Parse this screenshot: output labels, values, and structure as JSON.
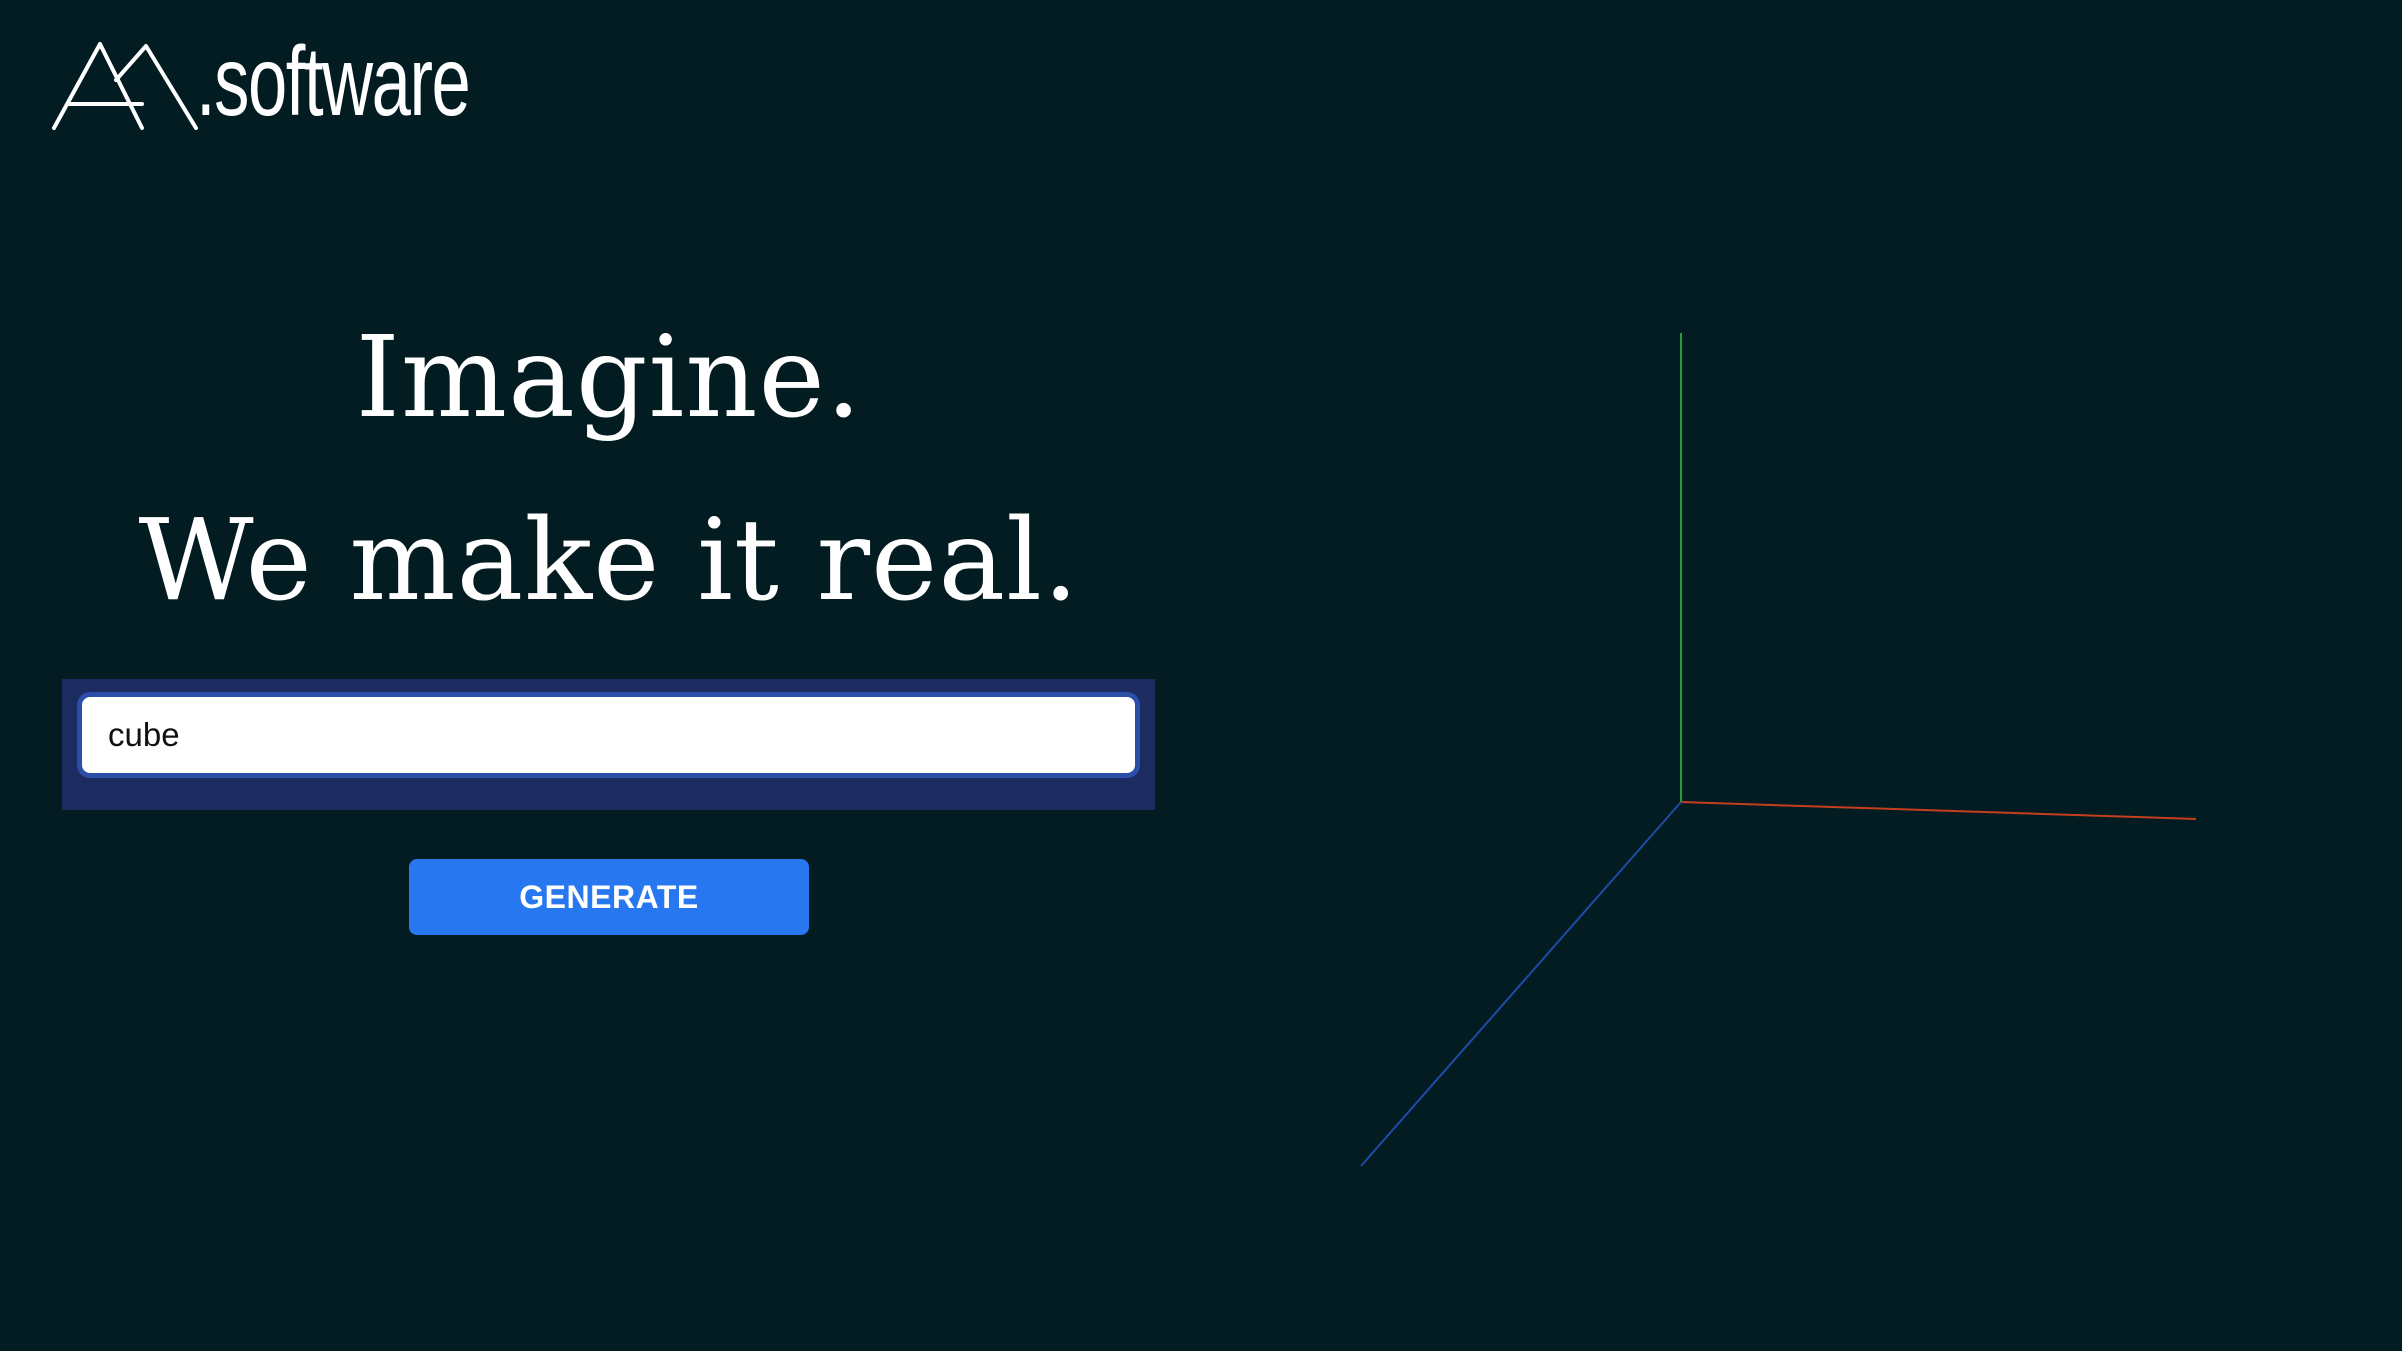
{
  "brand": {
    "logo_icon": "mountain-peaks-icon",
    "name": ".software"
  },
  "hero": {
    "line1": "Imagine.",
    "line2": "We make it real."
  },
  "prompt": {
    "value": "cube",
    "placeholder": ""
  },
  "generate_button": {
    "label": "GENERATE"
  },
  "viewport": {
    "axes": {
      "x_color": "#c4401c",
      "y_color": "#2f9a2f",
      "z_color": "#1f4aa8"
    }
  },
  "colors": {
    "background": "#021c22",
    "panel": "#1c2c61",
    "accent": "#2778f0"
  }
}
